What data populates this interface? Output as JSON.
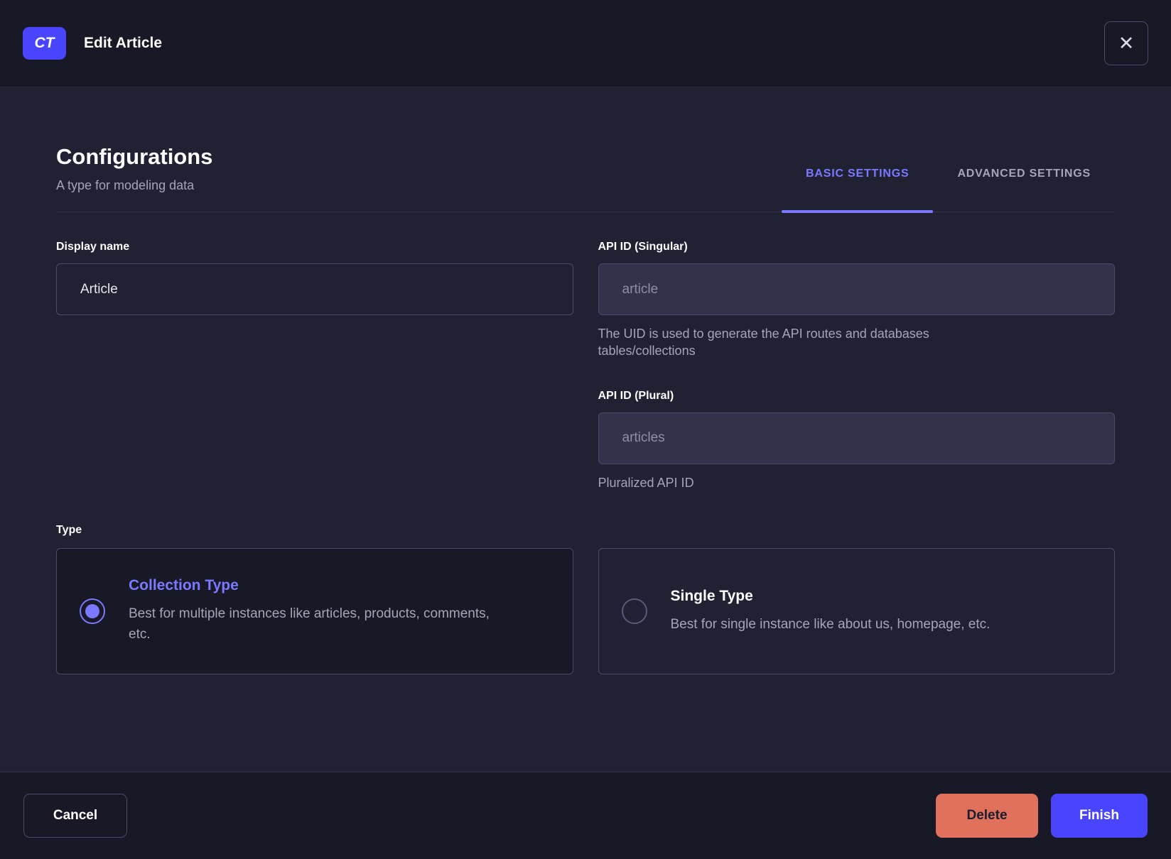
{
  "header": {
    "badge": "CT",
    "title": "Edit Article",
    "close_icon": "✕"
  },
  "main": {
    "title": "Configurations",
    "subtitle": "A type for modeling data",
    "tabs": [
      {
        "label": "BASIC SETTINGS",
        "active": true
      },
      {
        "label": "ADVANCED SETTINGS",
        "active": false
      }
    ],
    "fields": {
      "display_name": {
        "label": "Display name",
        "value": "Article"
      },
      "api_id_singular": {
        "label": "API ID (Singular)",
        "value": "article",
        "hint": "The UID is used to generate the API routes and databases tables/collections"
      },
      "api_id_plural": {
        "label": "API ID (Plural)",
        "value": "articles",
        "hint": "Pluralized API ID"
      }
    },
    "type": {
      "label": "Type",
      "options": [
        {
          "title": "Collection Type",
          "description": "Best for multiple instances like articles, products, comments, etc.",
          "selected": true
        },
        {
          "title": "Single Type",
          "description": "Best for single instance like about us, homepage, etc.",
          "selected": false
        }
      ]
    }
  },
  "footer": {
    "cancel_label": "Cancel",
    "delete_label": "Delete",
    "finish_label": "Finish"
  },
  "colors": {
    "primary": "#4945ff",
    "primary_light": "#7b79ff",
    "danger": "#e0715c",
    "danger_text": "#1c1c2e",
    "bg_dark": "#181826",
    "bg_body": "#212134",
    "border": "#4a4a6a",
    "divider": "#32324d",
    "text": "#ffffff",
    "text_secondary": "#a5a5ba",
    "text_muted": "#8e8ea9",
    "input_disabled_bg": "#32324d"
  }
}
